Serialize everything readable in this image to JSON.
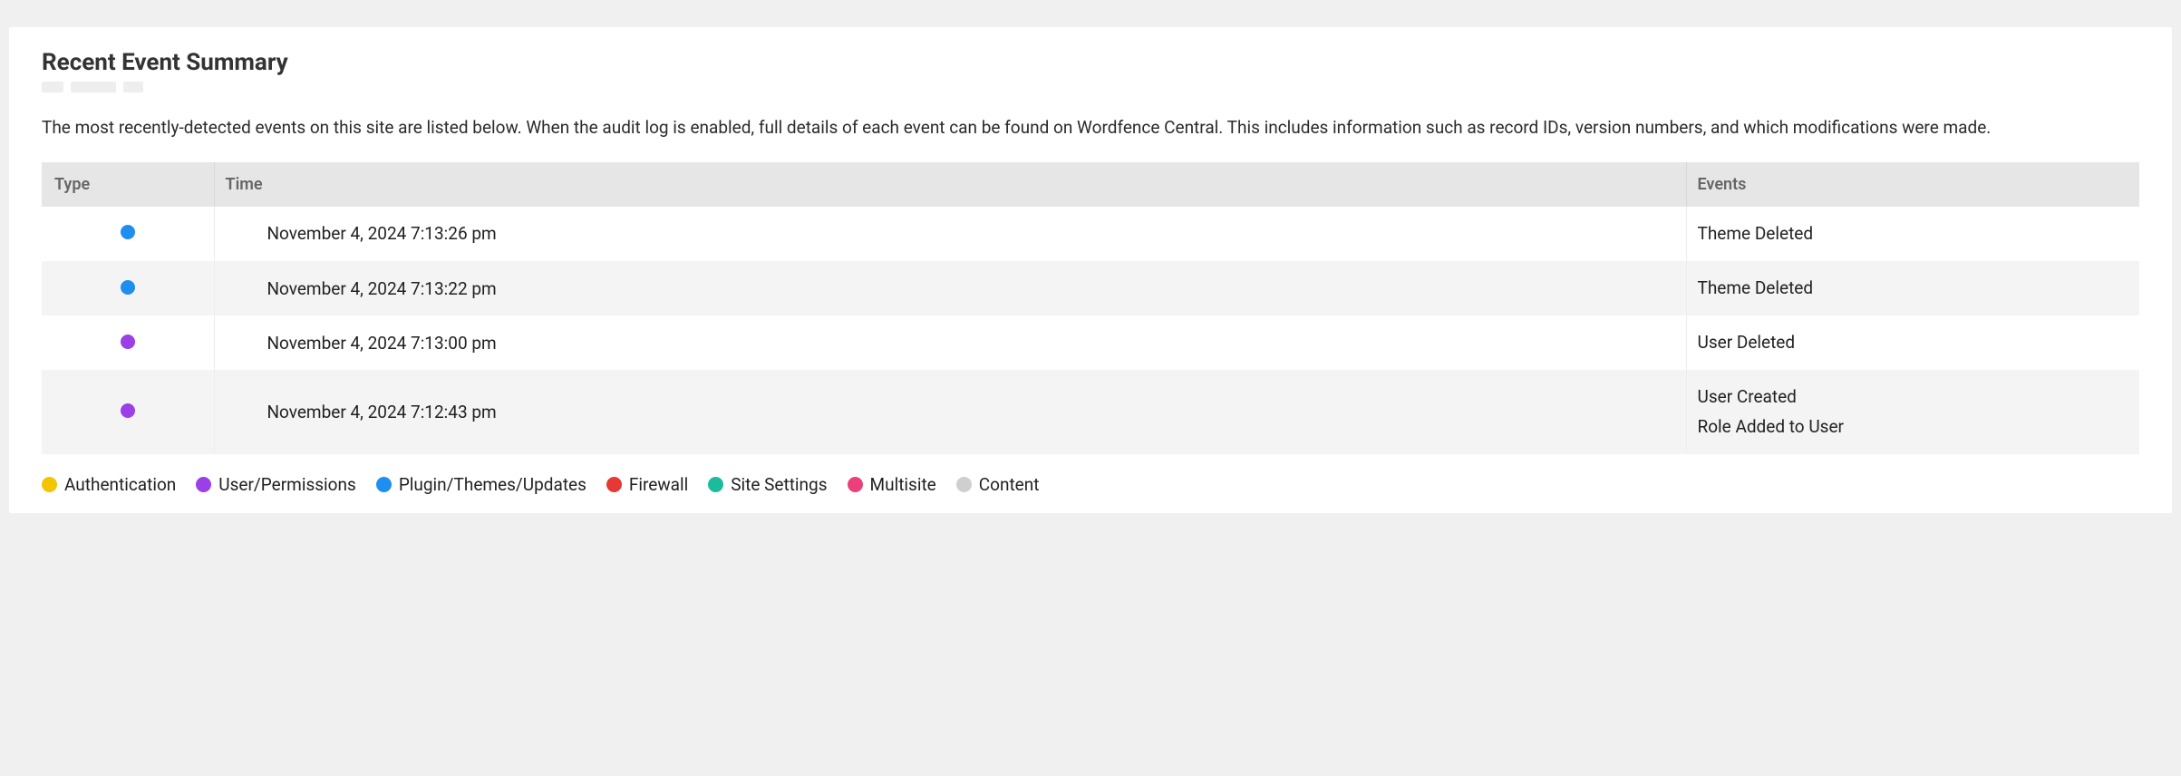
{
  "title": "Recent Event Summary",
  "description": "The most recently-detected events on this site are listed below. When the audit log is enabled, full details of each event can be found on Wordfence Central. This includes information such as record IDs, version numbers, and which modifications were made.",
  "columns": {
    "type": "Type",
    "time": "Time",
    "events": "Events"
  },
  "categories": {
    "authentication": {
      "label": "Authentication",
      "color": "#f5c400"
    },
    "user_permissions": {
      "label": "User/Permissions",
      "color": "#9b3fe6"
    },
    "plugin_themes": {
      "label": "Plugin/Themes/Updates",
      "color": "#1f8ef1"
    },
    "firewall": {
      "label": "Firewall",
      "color": "#e53935"
    },
    "site_settings": {
      "label": "Site Settings",
      "color": "#1abc9c"
    },
    "multisite": {
      "label": "Multisite",
      "color": "#ec407a"
    },
    "content": {
      "label": "Content",
      "color": "#cfcfcf"
    }
  },
  "legend_order": [
    "authentication",
    "user_permissions",
    "plugin_themes",
    "firewall",
    "site_settings",
    "multisite",
    "content"
  ],
  "rows": [
    {
      "category": "plugin_themes",
      "time": "November 4, 2024 7:13:26 pm",
      "events": [
        "Theme Deleted"
      ]
    },
    {
      "category": "plugin_themes",
      "time": "November 4, 2024 7:13:22 pm",
      "events": [
        "Theme Deleted"
      ]
    },
    {
      "category": "user_permissions",
      "time": "November 4, 2024 7:13:00 pm",
      "events": [
        "User Deleted"
      ]
    },
    {
      "category": "user_permissions",
      "time": "November 4, 2024 7:12:43 pm",
      "events": [
        "User Created",
        "Role Added to User"
      ]
    }
  ]
}
